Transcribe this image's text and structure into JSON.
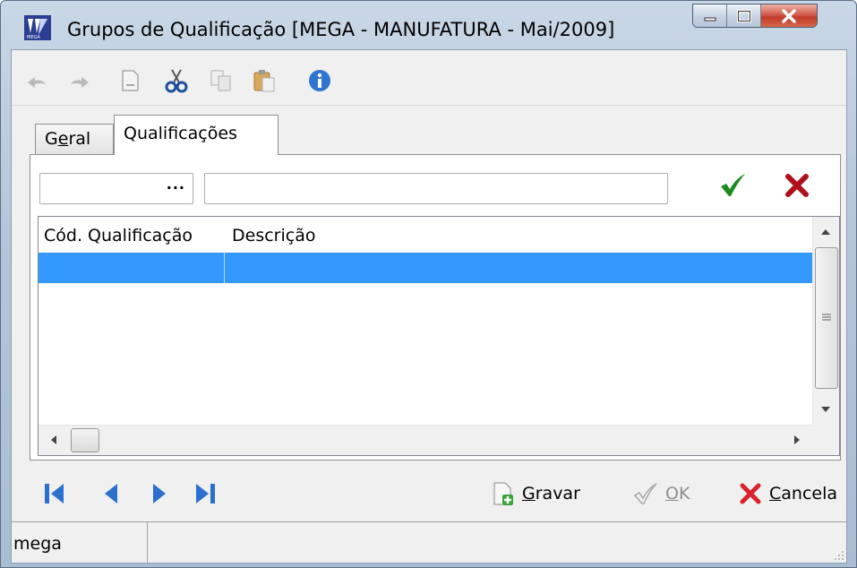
{
  "window": {
    "title": "Grupos de Qualificação [MEGA - MANUFATURA - Mai/2009]",
    "accent": "#3399ff"
  },
  "toolbar": {
    "icons": [
      "undo-icon",
      "redo-icon",
      "new-document-icon",
      "cut-icon",
      "copy-icon",
      "paste-icon",
      "info-icon"
    ]
  },
  "tabs": [
    {
      "label_pre": "G",
      "label_ul": "e",
      "label_post": "ral",
      "active": false
    },
    {
      "label": "Qualificações",
      "active": true
    }
  ],
  "filter": {
    "code_value": "",
    "lookup_label": "...",
    "description_value": ""
  },
  "grid": {
    "columns": [
      "Cód. Qualificação",
      "Descrição"
    ],
    "rows": [
      [
        "",
        ""
      ]
    ]
  },
  "actions": {
    "save": {
      "ul": "G",
      "rest": "ravar"
    },
    "ok": {
      "ul": "O",
      "rest": "K"
    },
    "cancel": {
      "ul": "C",
      "rest": "ancela"
    }
  },
  "status": {
    "user": "mega"
  }
}
